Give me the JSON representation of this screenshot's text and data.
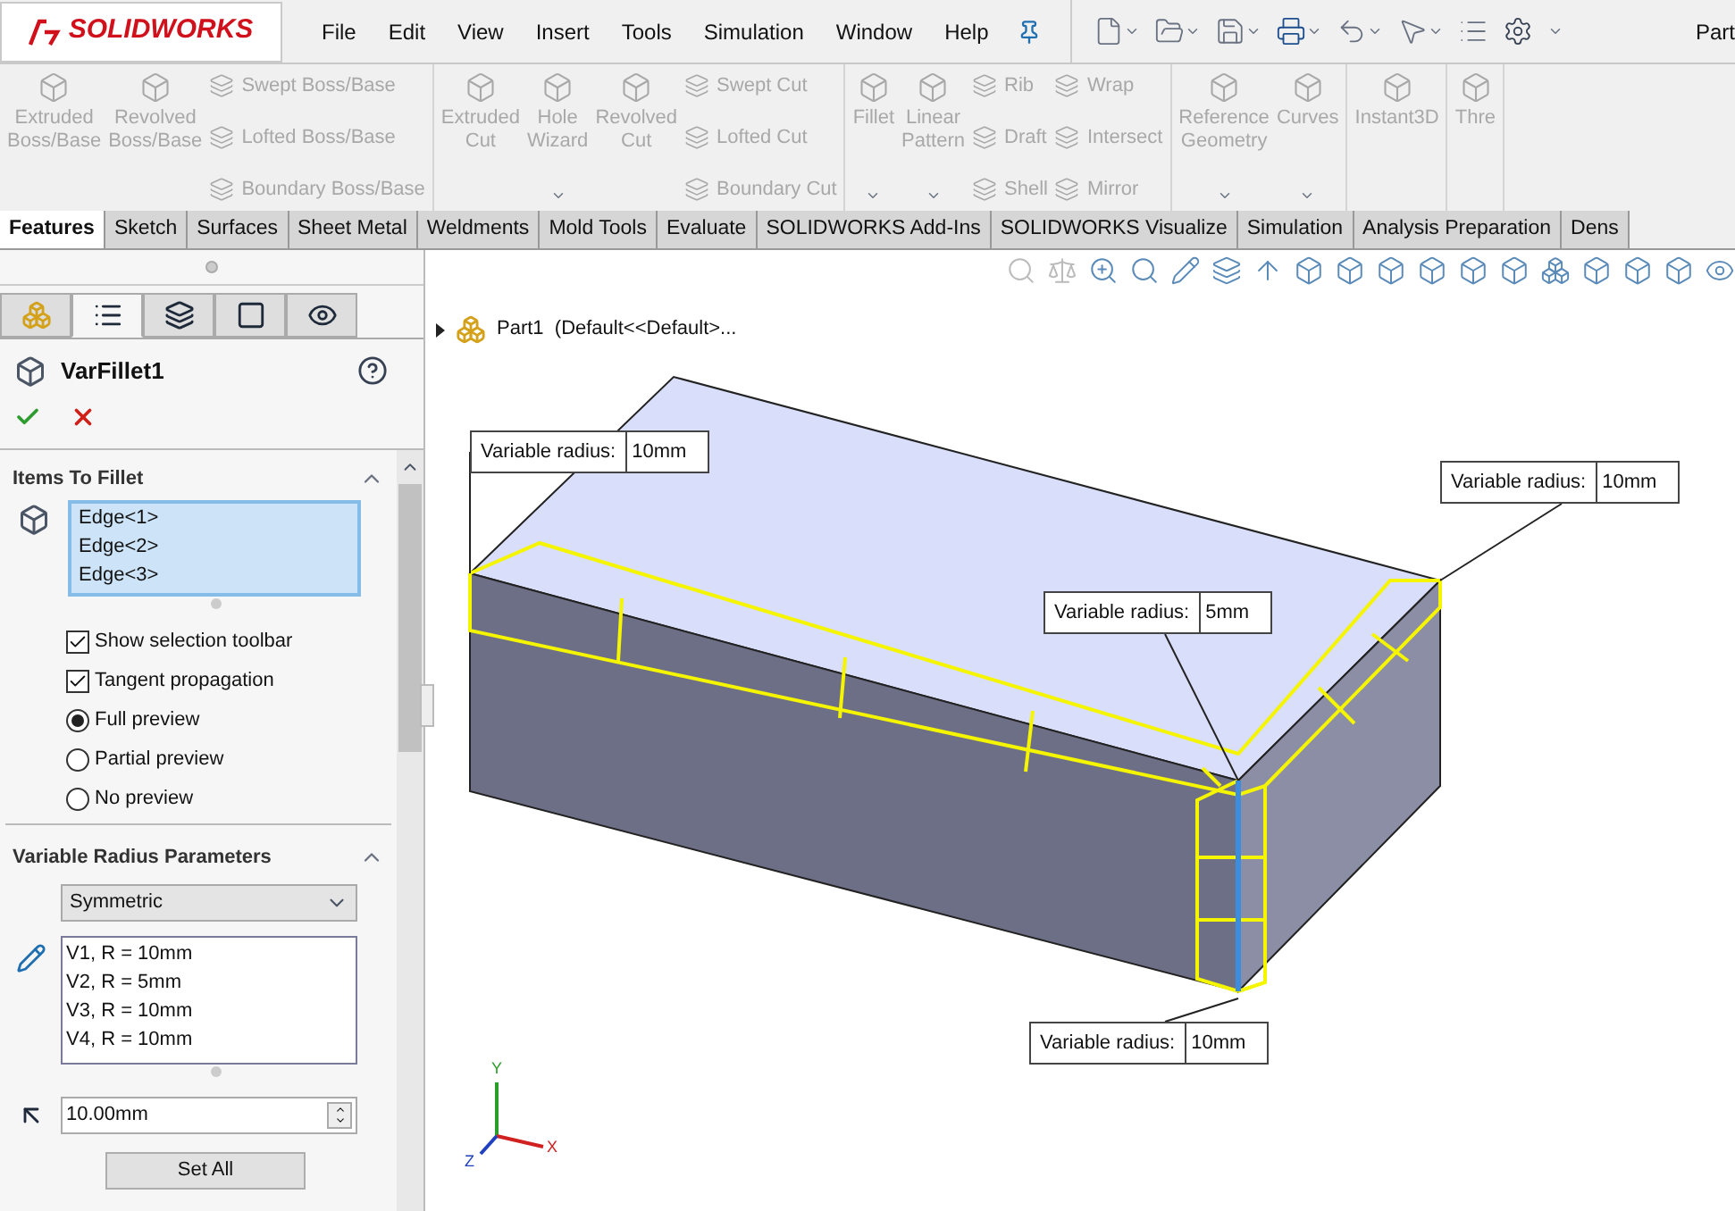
{
  "app": {
    "logo": "SOLIDWORKS",
    "menu": [
      "File",
      "Edit",
      "View",
      "Insert",
      "Tools",
      "Simulation",
      "Window",
      "Help"
    ],
    "doc_title": "Part"
  },
  "ribbon": {
    "disabled": true,
    "groups": [
      [
        {
          "kind": "large",
          "label": "Extruded\nBoss/Base",
          "dropdown": false
        },
        {
          "kind": "large",
          "label": "Revolved\nBoss/Base",
          "dropdown": false
        },
        {
          "kind": "stack",
          "items": [
            "Swept Boss/Base",
            "Lofted Boss/Base",
            "Boundary Boss/Base"
          ]
        }
      ],
      [
        {
          "kind": "large",
          "label": "Extruded\nCut",
          "dropdown": false
        },
        {
          "kind": "large",
          "label": "Hole\nWizard",
          "dropdown": true
        },
        {
          "kind": "large",
          "label": "Revolved\nCut",
          "dropdown": false
        },
        {
          "kind": "stack",
          "items": [
            "Swept Cut",
            "Lofted Cut",
            "Boundary Cut"
          ]
        }
      ],
      [
        {
          "kind": "large",
          "label": "Fillet",
          "dropdown": true
        },
        {
          "kind": "large",
          "label": "Linear\nPattern",
          "dropdown": true
        },
        {
          "kind": "stack",
          "items": [
            "Rib",
            "Draft",
            "Shell"
          ]
        },
        {
          "kind": "stack",
          "items": [
            "Wrap",
            "Intersect",
            "Mirror"
          ]
        }
      ],
      [
        {
          "kind": "large",
          "label": "Reference\nGeometry",
          "dropdown": true
        },
        {
          "kind": "large",
          "label": "Curves",
          "dropdown": true
        }
      ],
      [
        {
          "kind": "large",
          "label": "Instant3D",
          "dropdown": false
        }
      ],
      [
        {
          "kind": "large",
          "label": "Thre",
          "dropdown": false
        }
      ]
    ]
  },
  "tabs": [
    {
      "label": "Features",
      "selected": true
    },
    {
      "label": "Sketch",
      "selected": false
    },
    {
      "label": "Surfaces",
      "selected": false
    },
    {
      "label": "Sheet Metal",
      "selected": false
    },
    {
      "label": "Weldments",
      "selected": false
    },
    {
      "label": "Mold Tools",
      "selected": false
    },
    {
      "label": "Evaluate",
      "selected": false
    },
    {
      "label": "SOLIDWORKS Add-Ins",
      "selected": false
    },
    {
      "label": "SOLIDWORKS Visualize",
      "selected": false
    },
    {
      "label": "Simulation",
      "selected": false
    },
    {
      "label": "Analysis Preparation",
      "selected": false
    },
    {
      "label": "Dens",
      "selected": false
    }
  ],
  "panel_tabs": [
    {
      "selected": false
    },
    {
      "selected": true
    },
    {
      "selected": false
    },
    {
      "selected": false
    },
    {
      "selected": false
    }
  ],
  "property_manager": {
    "title": "VarFillet1",
    "items_to_fillet": {
      "heading": "Items To Fillet",
      "edges": [
        "Edge<1>",
        "Edge<2>",
        "Edge<3>"
      ],
      "options": [
        {
          "kind": "checkbox",
          "label": "Show selection toolbar",
          "checked": true
        },
        {
          "kind": "checkbox",
          "label": "Tangent propagation",
          "checked": true
        },
        {
          "kind": "radio",
          "label": "Full preview",
          "checked": true
        },
        {
          "kind": "radio",
          "label": "Partial preview",
          "checked": false
        },
        {
          "kind": "radio",
          "label": "No preview",
          "checked": false
        }
      ]
    },
    "variable_radius": {
      "heading": "Variable Radius Parameters",
      "profile": "Symmetric",
      "vertices": [
        "V1, R = 10mm",
        "V2, R = 5mm",
        "V3, R = 10mm",
        "V4, R = 10mm"
      ],
      "radius": "10.00mm",
      "set_all": "Set All"
    }
  },
  "viewport": {
    "tree_item": "Part1  (Default<<Default>...",
    "callouts": [
      {
        "label": "Variable radius:",
        "value": "10mm"
      },
      {
        "label": "Variable radius:",
        "value": "10mm"
      },
      {
        "label": "Variable radius:",
        "value": "5mm"
      },
      {
        "label": "Variable radius:",
        "value": "10mm"
      }
    ],
    "axes": [
      "Y",
      "X",
      "Z"
    ]
  }
}
